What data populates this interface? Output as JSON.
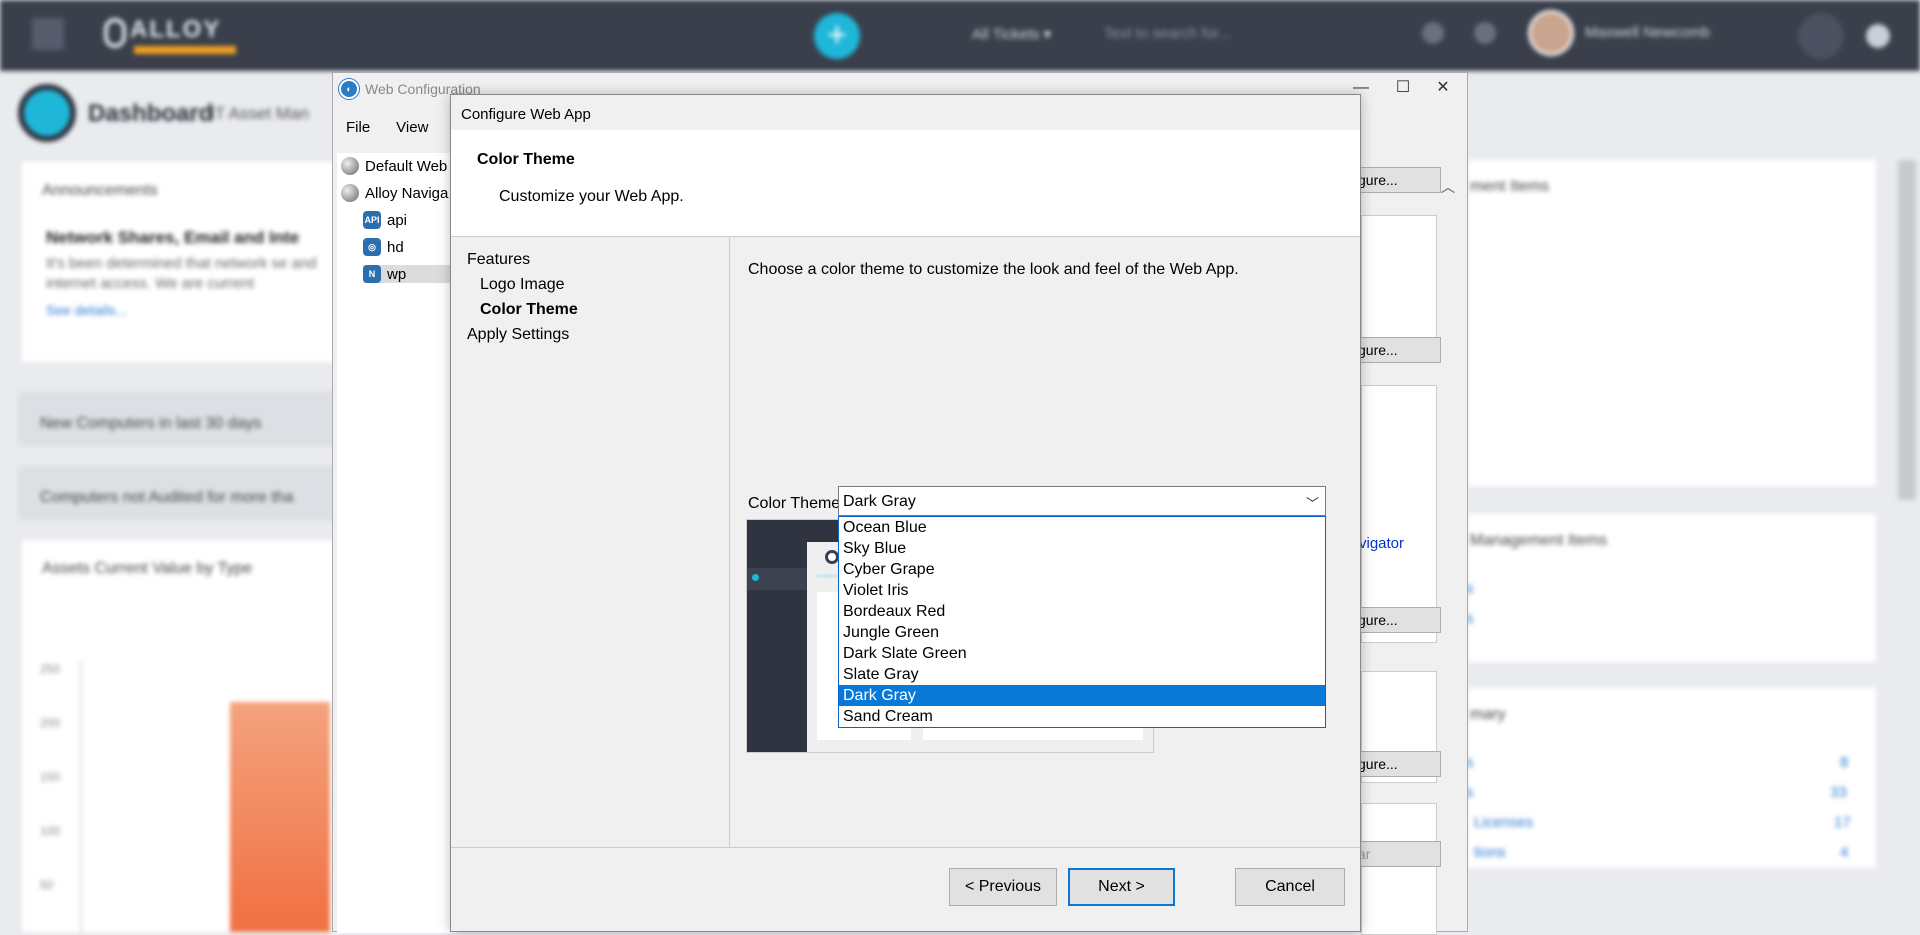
{
  "background": {
    "user_name": "Maxwell Newcomb",
    "tickets_select": "All Tickets",
    "search_placeholder": "Text to search for...",
    "logo_text": "ALLOY",
    "dashboard_title": "Dashboard",
    "dashboard_subtitle": "IT Asset Man",
    "announcements_title": "Announcements",
    "news_heading": "Network Shares, Email and Inte",
    "news_body": "It's been determined that network se and internet access. We are current",
    "news_link": "See details...",
    "row1": "New Computers in last 30 days",
    "row2": "Computers not Audited for more tha",
    "chart_title": "Assets Current Value by Type",
    "y_ticks": [
      "250",
      "200",
      "150",
      "100",
      "50"
    ],
    "right_card1": "ment Items",
    "right_card2": "Management Items",
    "right_card3": "mary",
    "right_links": [
      "s",
      "s",
      "s",
      "s",
      "Licenses",
      "tions"
    ],
    "right_counts": [
      "8",
      "33",
      "17",
      "4"
    ]
  },
  "webconfig": {
    "window_title": "Web Configuration",
    "menu": [
      "File",
      "View"
    ],
    "tree": [
      "Default Web",
      "Alloy Naviga",
      "api",
      "hd",
      "wp"
    ],
    "tree_icons": [
      "globe-icon",
      "globe-icon",
      "api-icon",
      "hd-icon",
      "wp-icon"
    ],
    "configure_label": "gure...",
    "navigator_link": "vigator",
    "clear_label": "ar"
  },
  "dialog": {
    "title": "Configure Web App",
    "header_title": "Color Theme",
    "header_subtitle": "Customize your Web App.",
    "nav": {
      "features": "Features",
      "logo_image": "Logo Image",
      "color_theme": "Color Theme",
      "apply_settings": "Apply Settings"
    },
    "instruction": "Choose a color theme to customize the look and feel of the Web App.",
    "color_theme_label": "Color Theme:",
    "selected_theme": "Dark Gray",
    "options": [
      "Ocean Blue",
      "Sky Blue",
      "Cyber Grape",
      "Violet Iris",
      "Bordeaux Red",
      "Jungle Green",
      "Dark Slate Green",
      "Slate Gray",
      "Dark Gray",
      "Sand Cream"
    ],
    "highlighted_index": 8,
    "buttons": {
      "previous": "< Previous",
      "next": "Next >",
      "cancel": "Cancel"
    }
  },
  "colors": {
    "accent": "#0a78d7",
    "topbar": "#3a3f4b",
    "brand_cyan": "#1fb7d9",
    "brand_orange": "#f0a020"
  }
}
